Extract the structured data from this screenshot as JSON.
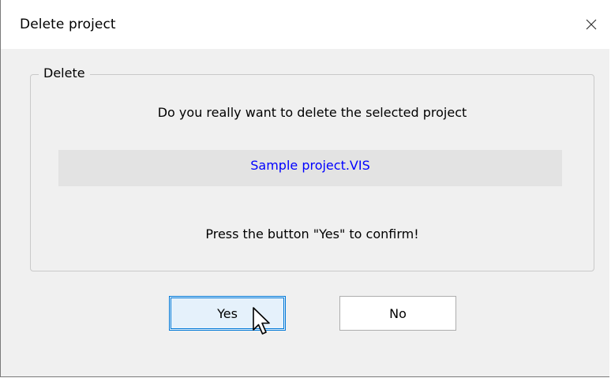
{
  "window": {
    "title": "Delete project",
    "close_icon": "close-icon"
  },
  "group": {
    "legend": "Delete",
    "question": "Do you really want to delete the selected project",
    "project_name": "Sample project.VIS",
    "confirm_hint": "Press the button \"Yes\" to confirm!"
  },
  "buttons": {
    "yes_label": "Yes",
    "no_label": "No"
  },
  "colors": {
    "project_name": "#0000ff",
    "default_button_border": "#0078d7",
    "default_button_bg": "#e5f1fb"
  },
  "cursor": {
    "icon": "mouse-pointer-icon"
  }
}
